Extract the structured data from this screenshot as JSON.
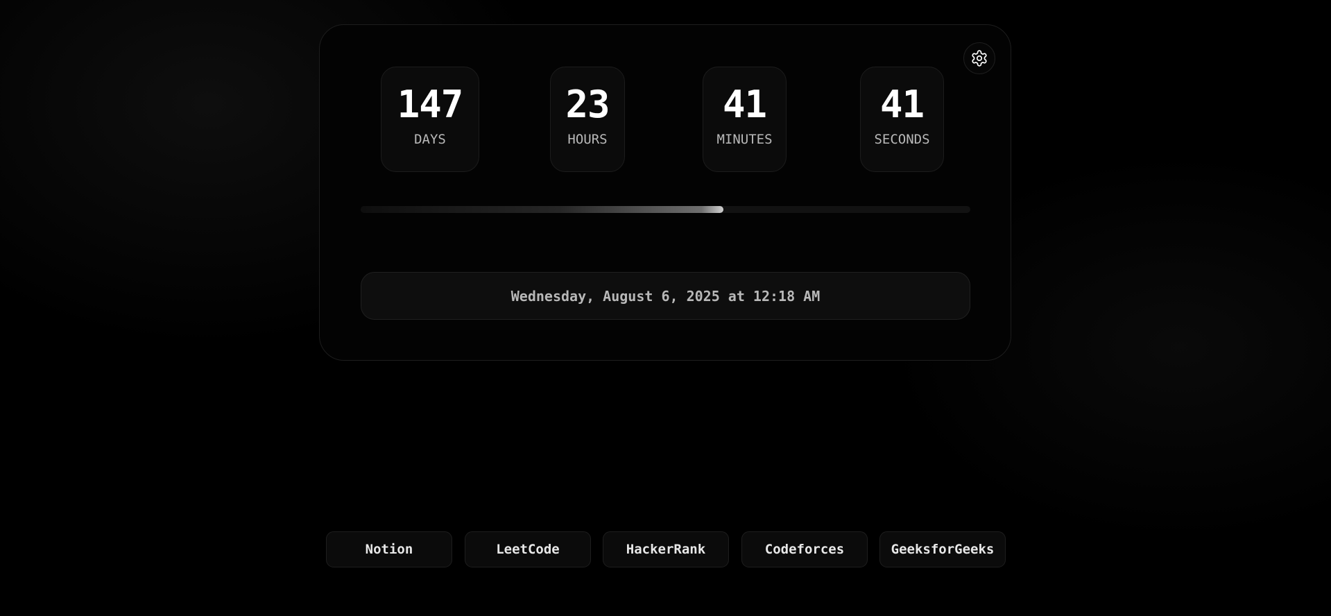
{
  "settings": {
    "icon": "gear-icon"
  },
  "countdown": [
    {
      "value": "147",
      "label": "DAYS"
    },
    {
      "value": "23",
      "label": "HOURS"
    },
    {
      "value": "41",
      "label": "MINUTES"
    },
    {
      "value": "41",
      "label": "SECONDS"
    }
  ],
  "progress": {
    "fraction": 0.595
  },
  "datetime": "Wednesday, August 6, 2025 at 12:18 AM",
  "links": [
    {
      "label": "Notion"
    },
    {
      "label": "LeetCode"
    },
    {
      "label": "HackerRank"
    },
    {
      "label": "Codeforces"
    },
    {
      "label": "GeeksforGeeks"
    }
  ],
  "colors": {
    "background": "#000000",
    "card_border": "#1d1d1d",
    "text_primary": "#ffffff",
    "text_secondary": "#b9b9b9"
  }
}
